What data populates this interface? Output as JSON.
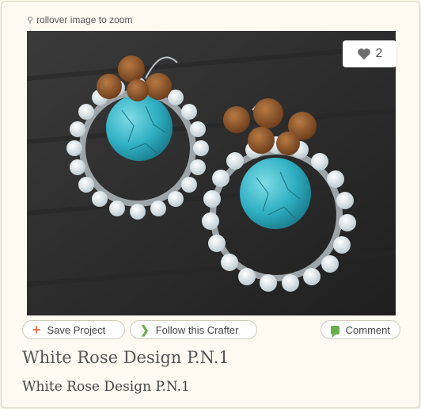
{
  "zoom_hint": "rollover image to zoom",
  "like": {
    "count": "2",
    "icon": "heart-icon"
  },
  "actions": {
    "save_label": "Save Project",
    "follow_label": "Follow this Crafter",
    "comment_label": "Comment"
  },
  "project": {
    "title": "White Rose Design P.N.1",
    "subtitle": "White Rose Design P.N.1"
  },
  "colors": {
    "accent_orange": "#e8734a",
    "accent_green": "#6ab04c",
    "turquoise": "#3ab7c8"
  }
}
